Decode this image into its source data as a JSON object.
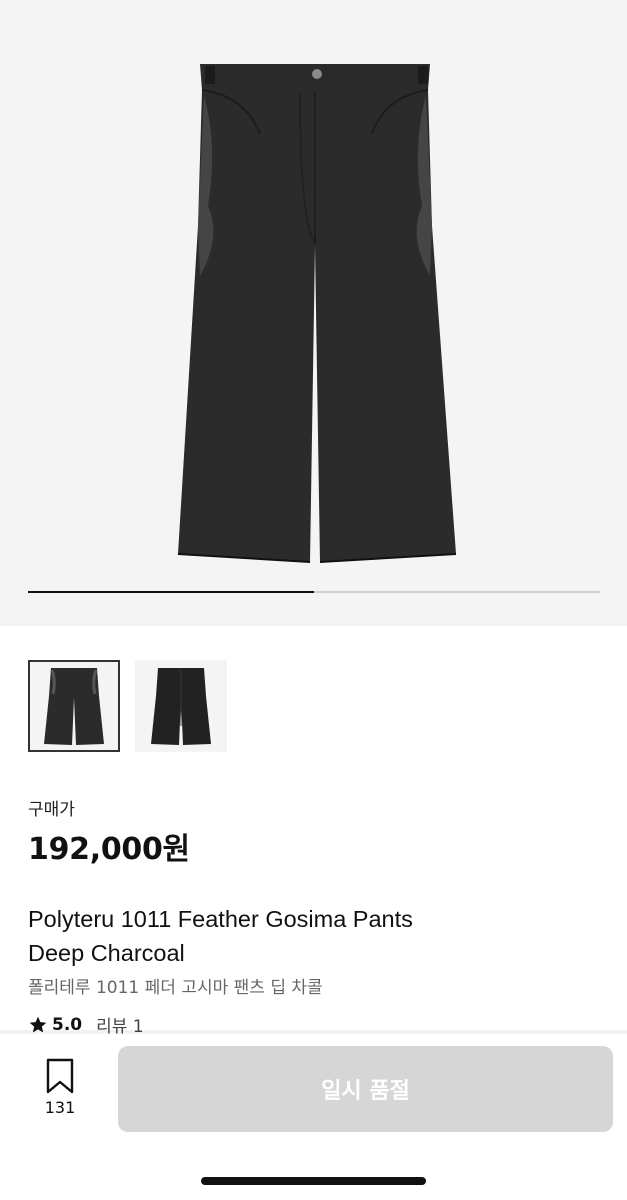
{
  "gallery": {
    "main_image": "black-wide-leg-pants-photo",
    "progress": 0.5,
    "thumbnails": [
      {
        "image": "pants-front-view",
        "selected": true
      },
      {
        "image": "pants-back-view",
        "selected": false
      }
    ]
  },
  "product": {
    "price_label": "구매가",
    "price": "192,000원",
    "title_en_line1": "Polyteru 1011 Feather Gosima Pants",
    "title_en_line2": "Deep Charcoal",
    "title_ko": "폴리테루 1011 페더 고시마 팬츠 딥 차콜",
    "rating_icon": "star-icon",
    "rating": "5.0",
    "review_label": "리뷰 1"
  },
  "bottom_bar": {
    "bookmark_icon": "bookmark-icon",
    "bookmark_count": "131",
    "action_label": "일시 품절",
    "action_color": "#d6d6d6"
  }
}
